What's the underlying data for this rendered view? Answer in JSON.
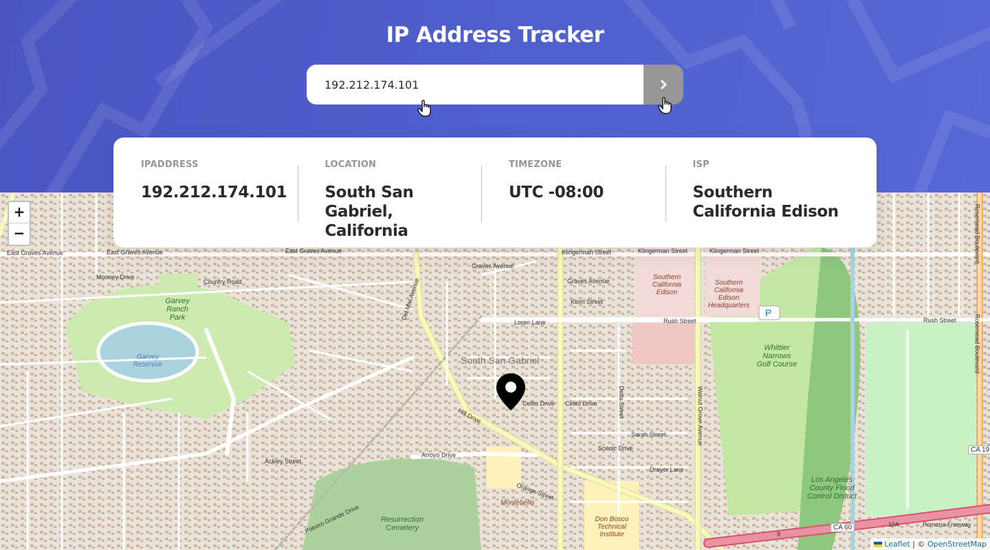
{
  "header": {
    "title": "IP Address Tracker"
  },
  "search": {
    "value": "192.212.174.101",
    "submit_icon": "chevron-right-icon"
  },
  "info": {
    "ip": {
      "label": "IPAddress",
      "value": "192.212.174.101"
    },
    "location": {
      "label": "Location",
      "value": "South San Gabriel, California"
    },
    "timezone": {
      "label": "Timezone",
      "value": "UTC -08:00"
    },
    "isp": {
      "label": "ISP",
      "value": "Southern California Edison"
    }
  },
  "map": {
    "zoom_in": "+",
    "zoom_out": "−",
    "attribution": {
      "leaflet": "Leaflet",
      "separator": " | © ",
      "osm": "OpenStreetMap"
    },
    "labels": {
      "town": "South San Gabriel",
      "garvey_park": "Garvey Ranch Park",
      "garvey_reservoir": "Garvey Reservoir",
      "sce": "Southern California Edison",
      "sce_hq": "Southern California Edison Headquarters",
      "golf": "Whittier Narrows Golf Course",
      "cemetery": "Resurrection Cemetery",
      "flood": "Los Angeles County Flood Control District",
      "don_bosco": "Don Bosco Technical Institute",
      "montebello": "Montebello",
      "pomona_fwy": "Pomona Freeway",
      "ca60": "CA 60",
      "ca19": "CA 19",
      "east_graves": "East Graves Avenue",
      "graves": "Graves Avenue",
      "klingerman": "Klingerman Street",
      "rush": "Rush Street",
      "hill": "Hill Drive",
      "walnut": "Walnut Grove Avenue",
      "delmar": "Del Mar Avenue",
      "rosemead": "Rosemead Boulevard",
      "arroyo": "Arroyo Drive",
      "ackley": "Ackley Street",
      "potrero": "Potrero Grande Drive",
      "delta": "Delta Street",
      "sarah": "Sarah Street",
      "celito": "Celito Drive",
      "loren": "Loren Lane",
      "mooney": "Mooney Drive",
      "country": "Country Road",
      "scenic": "Scenic Drive",
      "drayer": "Drayer Lane",
      "orange": "Orange Street",
      "keim": "Keim Street",
      "pomona_10a": "10A",
      "r9": "9"
    }
  },
  "colors": {
    "header_bg": "#4f5fcb",
    "search_button": "#969696",
    "text_dark": "#2b2b2b",
    "label_gray": "#969696"
  }
}
